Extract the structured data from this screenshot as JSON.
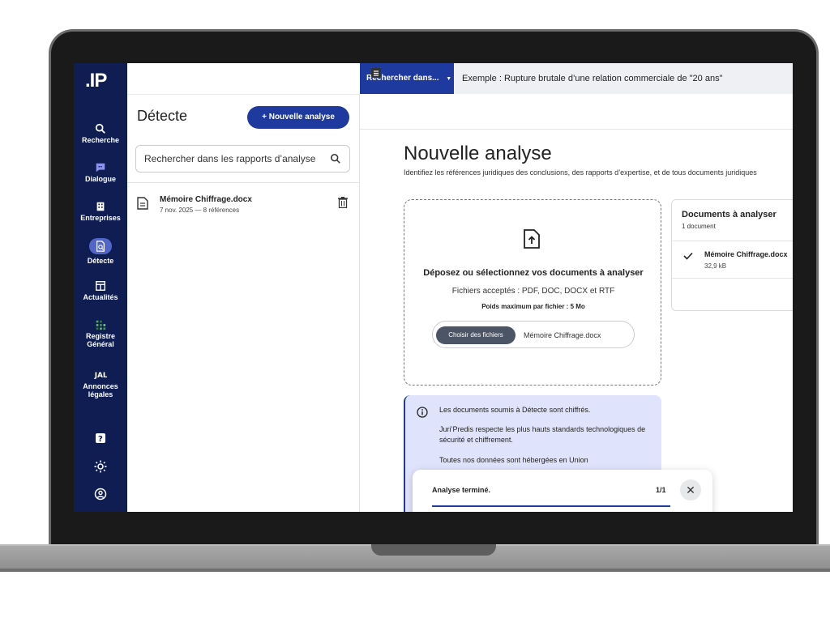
{
  "app": {
    "logo": ".IP"
  },
  "nav": {
    "items": [
      {
        "id": "recherche",
        "label": "Recherche",
        "icon": "search-icon"
      },
      {
        "id": "dialogue",
        "label": "Dialogue",
        "icon": "chat-icon"
      },
      {
        "id": "entreprises",
        "label": "Entreprises",
        "icon": "building-icon"
      },
      {
        "id": "detecte",
        "label": "Détecte",
        "icon": "document-search-icon",
        "active": true
      },
      {
        "id": "actualites",
        "label": "Actualités",
        "icon": "newspaper-icon"
      },
      {
        "id": "registre",
        "label": "Registre Général",
        "icon": "grid-icon"
      },
      {
        "id": "annonces",
        "label": "Annonces légales",
        "icon": "jal-icon"
      }
    ],
    "bottom_icons": [
      "help-icon",
      "brightness-icon",
      "account-icon"
    ]
  },
  "topbar": {
    "scope_label": "Rechercher dans...",
    "search_placeholder": "Exemple : Rupture brutale d’une relation commerciale de \"20 ans\""
  },
  "reports": {
    "title": "Détecte",
    "new_button": "+   Nouvelle analyse",
    "search_placeholder": "Rechercher dans les rapports d’analyse",
    "items": [
      {
        "name": "Mémoire Chiffrage.docx",
        "meta": "7 nov. 2025 — 8 références"
      }
    ]
  },
  "main": {
    "title": "Nouvelle analyse",
    "subtitle": "Identifiez les références juridiques des conclusions, des rapports d’expertise, et de tous documents juridiques",
    "dropzone": {
      "title": "Déposez ou sélectionnez vos documents à analyser",
      "formats": "Fichiers acceptés : PDF, DOC, DOCX et RTF",
      "max_size": "Poids maximum par fichier : 5 Mo",
      "choose_button": "Choisir des fichiers",
      "chosen_file": "Mémoire Chiffrage.docx"
    },
    "docs_card": {
      "title": "Documents à analyser",
      "count": "1 document",
      "files": [
        {
          "name": "Mémoire Chiffrage.docx",
          "size": "32,9 kB"
        }
      ]
    },
    "info": {
      "lines": [
        "Les documents soumis à Détecte sont chiffrés.",
        "Juri’Predis respecte les plus hauts standards technologiques de sécurité et chiffrement.",
        "Toutes nos données sont hébergées en Union"
      ]
    },
    "toast": {
      "text": "Analyse terminé.",
      "count": "1/1",
      "progress": 1.0
    }
  },
  "colors": {
    "rail": "#0f1d52",
    "accent": "#1e3a9e",
    "active_pill": "#5265c9",
    "info_bg": "#dfe3fb"
  }
}
